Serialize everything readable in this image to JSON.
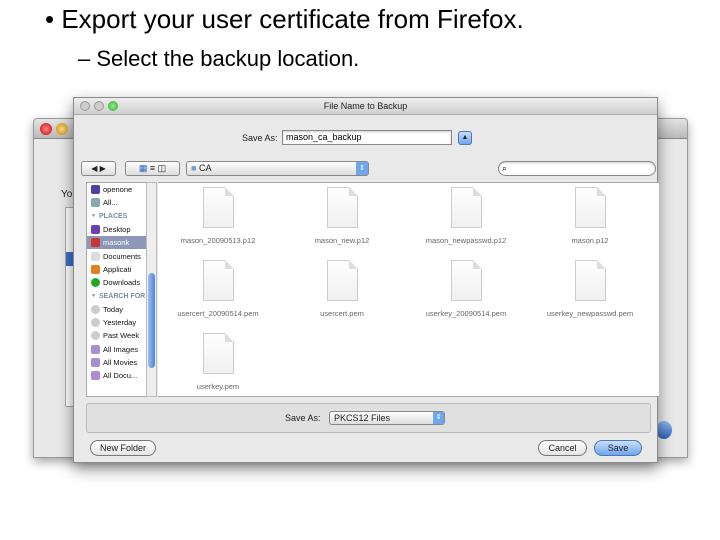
{
  "slide": {
    "bullet": "• Export your user certificate from Firefox.",
    "subbullet": "– Select the backup location."
  },
  "background_window": {
    "label_fragment": "You"
  },
  "dialog": {
    "title": "File Name to Backup",
    "save_as_label": "Save As:",
    "filename": "mason_ca_backup",
    "folder": "CA",
    "search_placeholder": "",
    "sidebar": [
      {
        "label": "openone",
        "type": "item",
        "icon": "display-icon"
      },
      {
        "label": "All...",
        "type": "item",
        "icon": "network-icon"
      },
      {
        "label": "PLACES",
        "type": "header"
      },
      {
        "label": "Desktop",
        "type": "item",
        "icon": "desktop-icon"
      },
      {
        "label": "masonk",
        "type": "item",
        "icon": "home-icon",
        "selected": true
      },
      {
        "label": "Documents",
        "type": "item",
        "icon": "documents-icon"
      },
      {
        "label": "Applicati",
        "type": "item",
        "icon": "applications-icon"
      },
      {
        "label": "Downloads",
        "type": "item",
        "icon": "downloads-icon"
      },
      {
        "label": "SEARCH FOR",
        "type": "header"
      },
      {
        "label": "Today",
        "type": "item",
        "icon": "clock-icon"
      },
      {
        "label": "Yesterday",
        "type": "item",
        "icon": "clock-icon"
      },
      {
        "label": "Past Week",
        "type": "item",
        "icon": "clock-icon"
      },
      {
        "label": "All Images",
        "type": "item",
        "icon": "smart-folder-icon"
      },
      {
        "label": "All Movies",
        "type": "item",
        "icon": "smart-folder-icon"
      },
      {
        "label": "All Docu...",
        "type": "item",
        "icon": "smart-folder-icon"
      }
    ],
    "files": [
      "mason_20090513.p12",
      "mason_new.p12",
      "mason_newpasswd.p12",
      "mason.p12",
      "usercert_20090514.pem",
      "usercert.pem",
      "userkey_20090514.pem",
      "userkey_newpasswd.pem",
      "userkey.pem"
    ],
    "format_label": "Save As:",
    "format": "PKCS12 Files",
    "new_folder": "New Folder",
    "cancel": "Cancel",
    "save": "Save"
  }
}
